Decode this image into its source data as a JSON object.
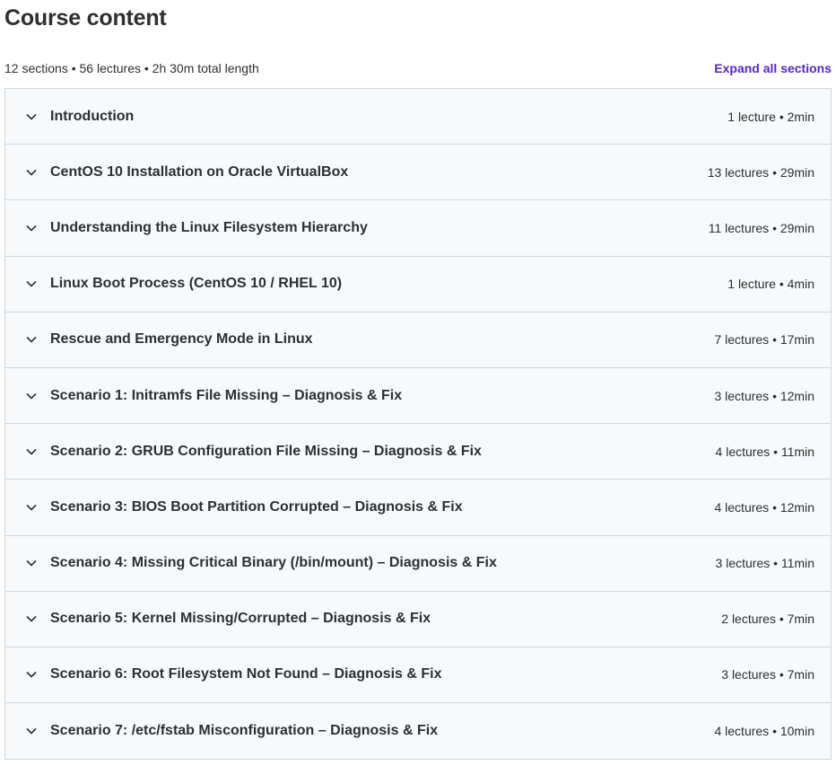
{
  "header": {
    "title": "Course content",
    "summary": "12 sections • 56 lectures • 2h 30m total length",
    "expand_label": "Expand all sections"
  },
  "icons": {
    "section_toggle": "chevron-down-icon"
  },
  "colors": {
    "link": "#5624d0",
    "section_bg": "#f7f9fa",
    "border": "#d1d7dc",
    "text": "#2d2f31"
  },
  "sections": [
    {
      "title": "Introduction",
      "meta": "1 lecture • 2min"
    },
    {
      "title": "CentOS 10 Installation on Oracle VirtualBox",
      "meta": "13 lectures • 29min"
    },
    {
      "title": "Understanding the Linux Filesystem Hierarchy",
      "meta": "11 lectures • 29min"
    },
    {
      "title": "Linux Boot Process (CentOS 10 / RHEL 10)",
      "meta": "1 lecture • 4min"
    },
    {
      "title": "Rescue and Emergency Mode in Linux",
      "meta": "7 lectures • 17min"
    },
    {
      "title": "Scenario 1: Initramfs File Missing – Diagnosis & Fix",
      "meta": "3 lectures • 12min"
    },
    {
      "title": "Scenario 2: GRUB Configuration File Missing – Diagnosis & Fix",
      "meta": "4 lectures • 11min"
    },
    {
      "title": "Scenario 3: BIOS Boot Partition Corrupted – Diagnosis & Fix",
      "meta": "4 lectures • 12min"
    },
    {
      "title": "Scenario 4: Missing Critical Binary (/bin/mount) – Diagnosis & Fix",
      "meta": "3 lectures • 11min"
    },
    {
      "title": "Scenario 5: Kernel Missing/Corrupted – Diagnosis & Fix",
      "meta": "2 lectures • 7min"
    },
    {
      "title": "Scenario 6: Root Filesystem Not Found – Diagnosis & Fix",
      "meta": "3 lectures • 7min"
    },
    {
      "title": "Scenario 7: /etc/fstab Misconfiguration – Diagnosis & Fix",
      "meta": "4 lectures • 10min"
    }
  ]
}
